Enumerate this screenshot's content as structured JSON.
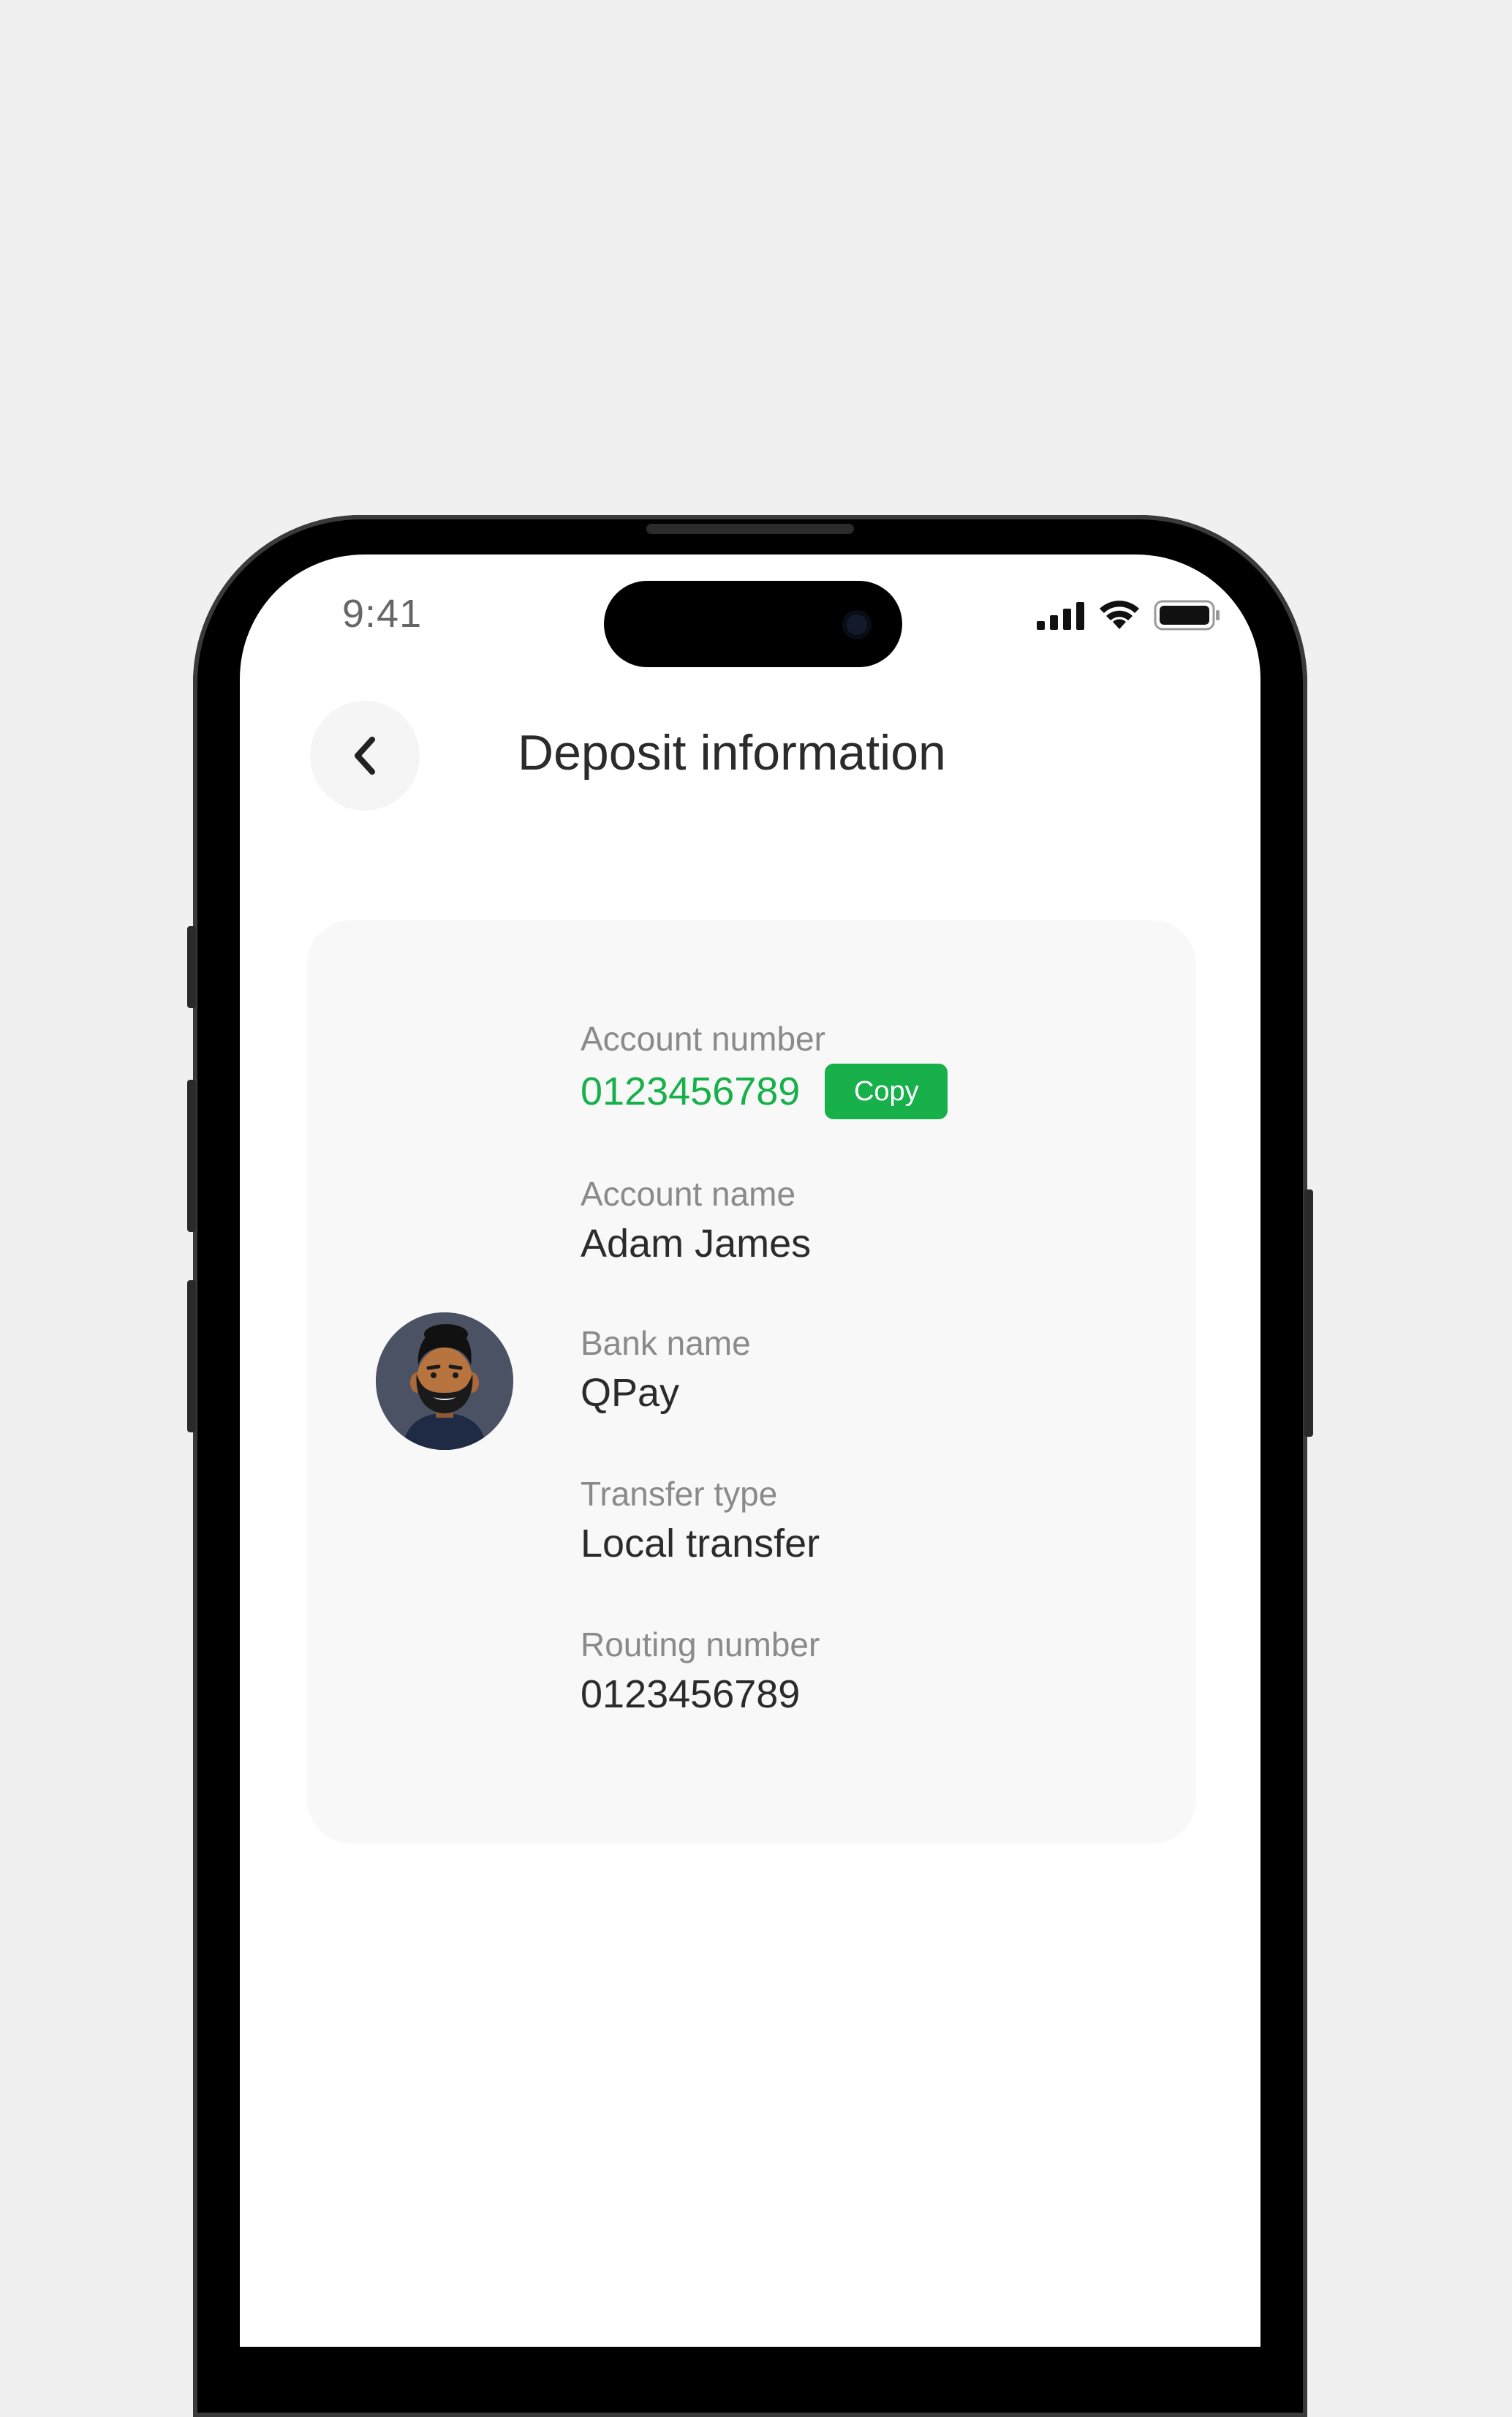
{
  "status_bar": {
    "time": "9:41"
  },
  "header": {
    "title": "Deposit information"
  },
  "deposit": {
    "account_number_label": "Account number",
    "account_number": "0123456789",
    "copy_label": "Copy",
    "account_name_label": "Account name",
    "account_name": "Adam James",
    "bank_name_label": "Bank name",
    "bank_name": "QPay",
    "transfer_type_label": "Transfer type",
    "transfer_type": "Local transfer",
    "routing_number_label": "Routing number",
    "routing_number": "0123456789"
  },
  "icons": {
    "back": "chevron-left-icon",
    "signal": "cellular-signal-icon",
    "wifi": "wifi-icon",
    "battery": "battery-icon"
  },
  "colors": {
    "accent": "#17b04a",
    "background": "#f0f0f0",
    "card": "#f8f8f8",
    "text": "#2b2b2b",
    "label": "#8a8a8a"
  }
}
